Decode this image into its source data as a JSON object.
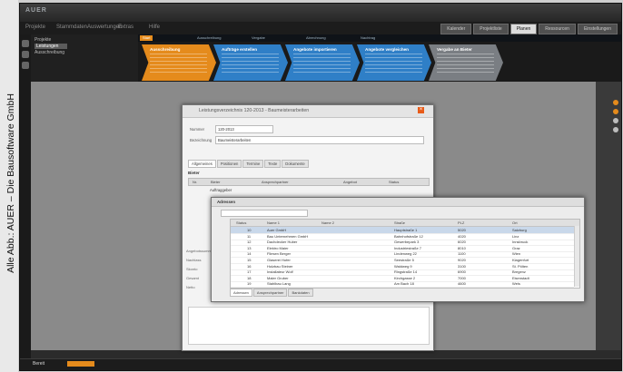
{
  "credit": "Alle Abb.: AUER – Die Bausoftware GmbH",
  "app": {
    "logo_text": "AUER",
    "menu": [
      "Projekte",
      "Stammdaten",
      "Auswertungen",
      "Extras",
      "Hilfe"
    ],
    "top_tabs": [
      "Kalender",
      "Projektliste",
      "Planen",
      "Ressourcen",
      "Einstellungen"
    ],
    "active_top_tab_index": 2,
    "nav_items": [
      "Projekte",
      "Leistungen",
      "Ausschreibung"
    ],
    "nav_selected_index": 1,
    "workflow_tabs": [
      "Start",
      "Ausschreibung",
      "Vergabe",
      "Abrechnung",
      "Nachtrag"
    ],
    "workflow_steps": [
      {
        "title": "Ausschreibung",
        "color": "#e58b1c"
      },
      {
        "title": "Aufträge erstellen",
        "color": "#2f7fc7"
      },
      {
        "title": "Angebote importieren",
        "color": "#2f7fc7"
      },
      {
        "title": "Angebote vergleichen",
        "color": "#2f7fc7"
      },
      {
        "title": "Vergabe an Bieter",
        "color": "#7a7e83"
      }
    ],
    "status_text": "Bereit"
  },
  "dialog1": {
    "title": "Leistungsverzeichnis 120-2013 - Baumeisterarbeiten",
    "fields": [
      {
        "label": "Nummer",
        "value": "120-2013"
      },
      {
        "label": "Bezeichnung",
        "value": "Baumeisterarbeiten"
      }
    ],
    "tabs": [
      "Allgemeines",
      "Positionen",
      "Termine",
      "Texte",
      "Dokumente"
    ],
    "section": "Bieter",
    "grid_cols": [
      "Nr.",
      "Bieter",
      "Ansprechpartner",
      "Angebot",
      "Status"
    ],
    "row_value": "Auftraggeber",
    "side_labels": [
      "Angebotssumme",
      "Nachlass",
      "Skonto",
      "Gesamt",
      "Netto"
    ]
  },
  "dialog2": {
    "title": "Adressen",
    "columns": [
      "Status",
      "Name 1",
      "Name 2",
      "Straße",
      "PLZ",
      "Ort"
    ],
    "rows": [
      {
        "num": "10",
        "name": "Auer GmbH",
        "street": "Hauptstraße 1",
        "zip": "5020",
        "city": "Salzburg"
      },
      {
        "num": "11",
        "name": "Bau Unternehmen GmbH",
        "street": "Bahnhofstraße 12",
        "zip": "4020",
        "city": "Linz"
      },
      {
        "num": "12",
        "name": "Dachdecker Huber",
        "street": "Gewerbepark 3",
        "zip": "6020",
        "city": "Innsbruck"
      },
      {
        "num": "13",
        "name": "Elektro Maier",
        "street": "Industriestraße 7",
        "zip": "8010",
        "city": "Graz"
      },
      {
        "num": "14",
        "name": "Fliesen Berger",
        "street": "Lindenweg 22",
        "zip": "1100",
        "city": "Wien"
      },
      {
        "num": "15",
        "name": "Glaserei Hofer",
        "street": "Seestraße 5",
        "zip": "9020",
        "city": "Klagenfurt"
      },
      {
        "num": "16",
        "name": "Holzbau Steiner",
        "street": "Waldweg 9",
        "zip": "3100",
        "city": "St. Pölten"
      },
      {
        "num": "17",
        "name": "Installateur Wolf",
        "street": "Ringstraße 14",
        "zip": "6900",
        "city": "Bregenz"
      },
      {
        "num": "18",
        "name": "Maler Gruber",
        "street": "Kirchgasse 2",
        "zip": "7000",
        "city": "Eisenstadt"
      },
      {
        "num": "19",
        "name": "Stahlbau Lang",
        "street": "Am Bach 18",
        "zip": "4600",
        "city": "Wels"
      }
    ],
    "selected_row_index": 0,
    "bottom_tabs": [
      "Adressen",
      "Ansprechpartner",
      "Bankdaten"
    ]
  }
}
